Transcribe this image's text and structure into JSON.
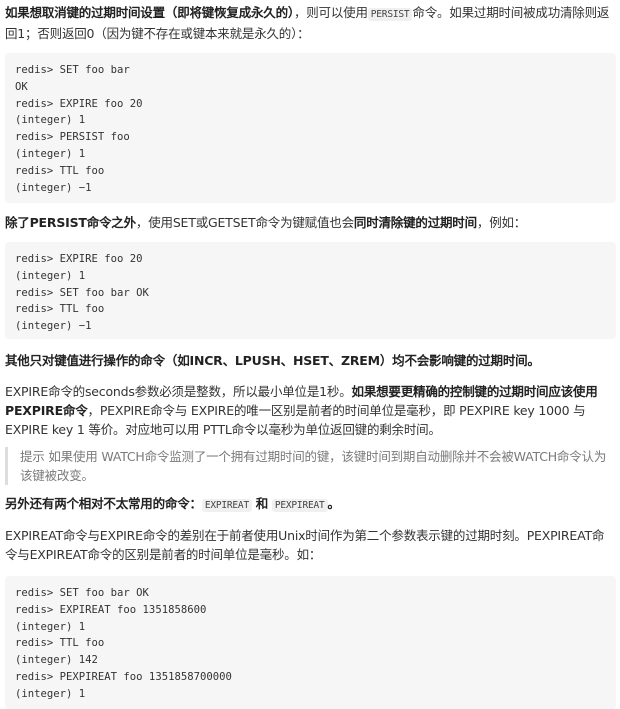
{
  "p1": {
    "bold": "如果想取消键的过期时间设置（即将键恢复成永久的）",
    "t1": "，则可以使用",
    "code": "PERSIST",
    "t2": "命令。如果过期时间被成功清除则返回1；否则返回0（因为键不存在或键本来就是永久的）："
  },
  "code1": [
    "redis> SET foo bar",
    "OK",
    "redis> EXPIRE foo 20",
    "(integer) 1",
    "redis> PERSIST foo",
    "(integer) 1",
    "redis> TTL foo",
    "(integer) −1"
  ],
  "p2": {
    "bold1": "除了PERSIST命令之外",
    "t1": "，使用SET或GETSET命令为键赋值也会",
    "bold2": "同时清除键的过期时间",
    "t2": "，例如："
  },
  "code2": [
    "redis> EXPIRE foo 20",
    "(integer) 1",
    "redis> SET foo bar OK",
    "redis> TTL foo",
    "(integer) −1"
  ],
  "p3": {
    "bold": "其他只对键值进行操作的命令（如INCR、LPUSH、HSET、ZREM）均不会影响键的过期时间。"
  },
  "p4": {
    "t1": "EXPIRE命令的seconds参数必须是整数，所以最小单位是1秒。",
    "bold1": "如果想要更精确的控制键的过期时间应该使用PEXPIRE命令",
    "t2": "，PEXPIRE命令与 EXPIRE的唯一区别是前者的时间单位是毫秒，即 PEXPIRE key 1000 与 EXPIRE key 1 等价。对应地可以用 PTTL命令以毫秒为单位返回键的剩余时间。"
  },
  "tip": {
    "text": "提示 如果使用 WATCH命令监测了一个拥有过期时间的键，该键时间到期自动删除并不会被WATCH命令认为该键被改变。"
  },
  "p5": {
    "bold": "另外还有两个相对不太常用的命令：",
    "code1": "EXPIREAT",
    "and": "和",
    "code2": "PEXPIREAT",
    "end": "。"
  },
  "p6": {
    "text": "EXPIREAT命令与EXPIRE命令的差别在于前者使用Unix时间作为第二个参数表示键的过期时刻。PEXPIREAT命令与EXPIREAT命令的区别是前者的时间单位是毫秒。如："
  },
  "code3": [
    "redis> SET foo bar OK",
    "redis> EXPIREAT foo 1351858600",
    "(integer) 1",
    "redis> TTL foo",
    "(integer) 142",
    "redis> PEXPIREAT foo 1351858700000",
    "(integer) 1"
  ]
}
